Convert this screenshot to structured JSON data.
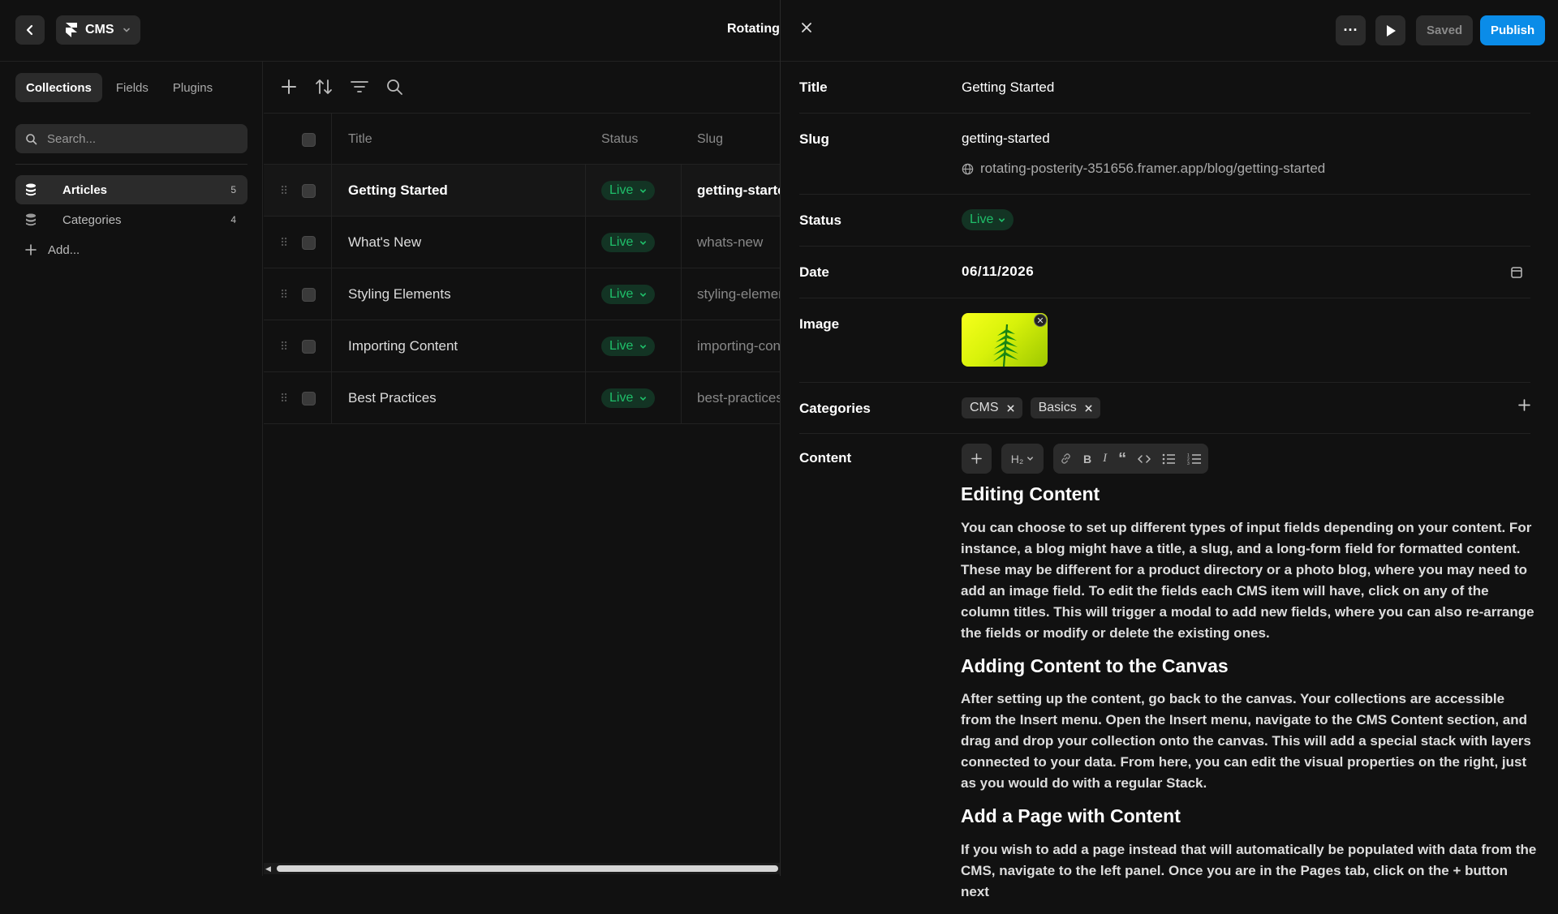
{
  "topbar": {
    "app_label": "CMS",
    "project_title": "Rotating"
  },
  "sidebar": {
    "tabs": [
      "Collections",
      "Fields",
      "Plugins"
    ],
    "search_placeholder": "Search...",
    "items": [
      {
        "label": "Articles",
        "count": "5"
      },
      {
        "label": "Categories",
        "count": "4"
      }
    ],
    "add_label": "Add..."
  },
  "table": {
    "headers": {
      "title": "Title",
      "status": "Status",
      "slug": "Slug"
    },
    "rows": [
      {
        "title": "Getting Started",
        "status": "Live",
        "slug": "getting-started"
      },
      {
        "title": "What's New",
        "status": "Live",
        "slug": "whats-new"
      },
      {
        "title": "Styling Elements",
        "status": "Live",
        "slug": "styling-elements"
      },
      {
        "title": "Importing Content",
        "status": "Live",
        "slug": "importing-content"
      },
      {
        "title": "Best Practices",
        "status": "Live",
        "slug": "best-practices"
      }
    ]
  },
  "editor": {
    "buttons": {
      "more": "···",
      "saved": "Saved",
      "publish": "Publish"
    },
    "fields": {
      "title_label": "Title",
      "title_value": "Getting Started",
      "slug_label": "Slug",
      "slug_value": "getting-started",
      "url": "rotating-posterity-351656.framer.app/blog/getting-started",
      "status_label": "Status",
      "status_value": "Live",
      "date_label": "Date",
      "date_value": "06/11/2026",
      "image_label": "Image",
      "categories_label": "Categories",
      "categories": [
        "CMS",
        "Basics"
      ],
      "content_label": "Content"
    },
    "content_toolbar": {
      "heading": "H₂"
    },
    "content": {
      "h1": "Editing Content",
      "p1": "You can choose to set up different types of input fields depending on your content. For instance, a blog might have a title, a slug, and a long-form field for formatted content. These may be different for a product directory or a photo blog, where you may need to add an image field. To edit the fields each CMS item will have, click on any of the column titles. This will trigger a modal to add new fields, where you can also re-arrange the fields or modify or delete the existing ones.",
      "h2": "Adding Content to the Canvas",
      "p2": "After setting up the content, go back to the canvas. Your collections are accessible from the Insert menu. Open the Insert menu, navigate to the CMS Content section, and drag and drop your collection onto the canvas. This will add a special stack with layers connected to your data. From here, you can edit the visual properties on the right, just as you would do with a regular Stack.",
      "h3": "Add a Page with Content",
      "p3": "If you wish to add a page instead that will automatically be populated with data from the CMS, navigate to the left panel. Once you are in the Pages tab, click on the + button next"
    }
  },
  "colors": {
    "accent": "#0a8ce8",
    "live": "#1fbf6a",
    "live_bg": "#133424",
    "panel": "#2b2b2b",
    "background": "#111111"
  }
}
